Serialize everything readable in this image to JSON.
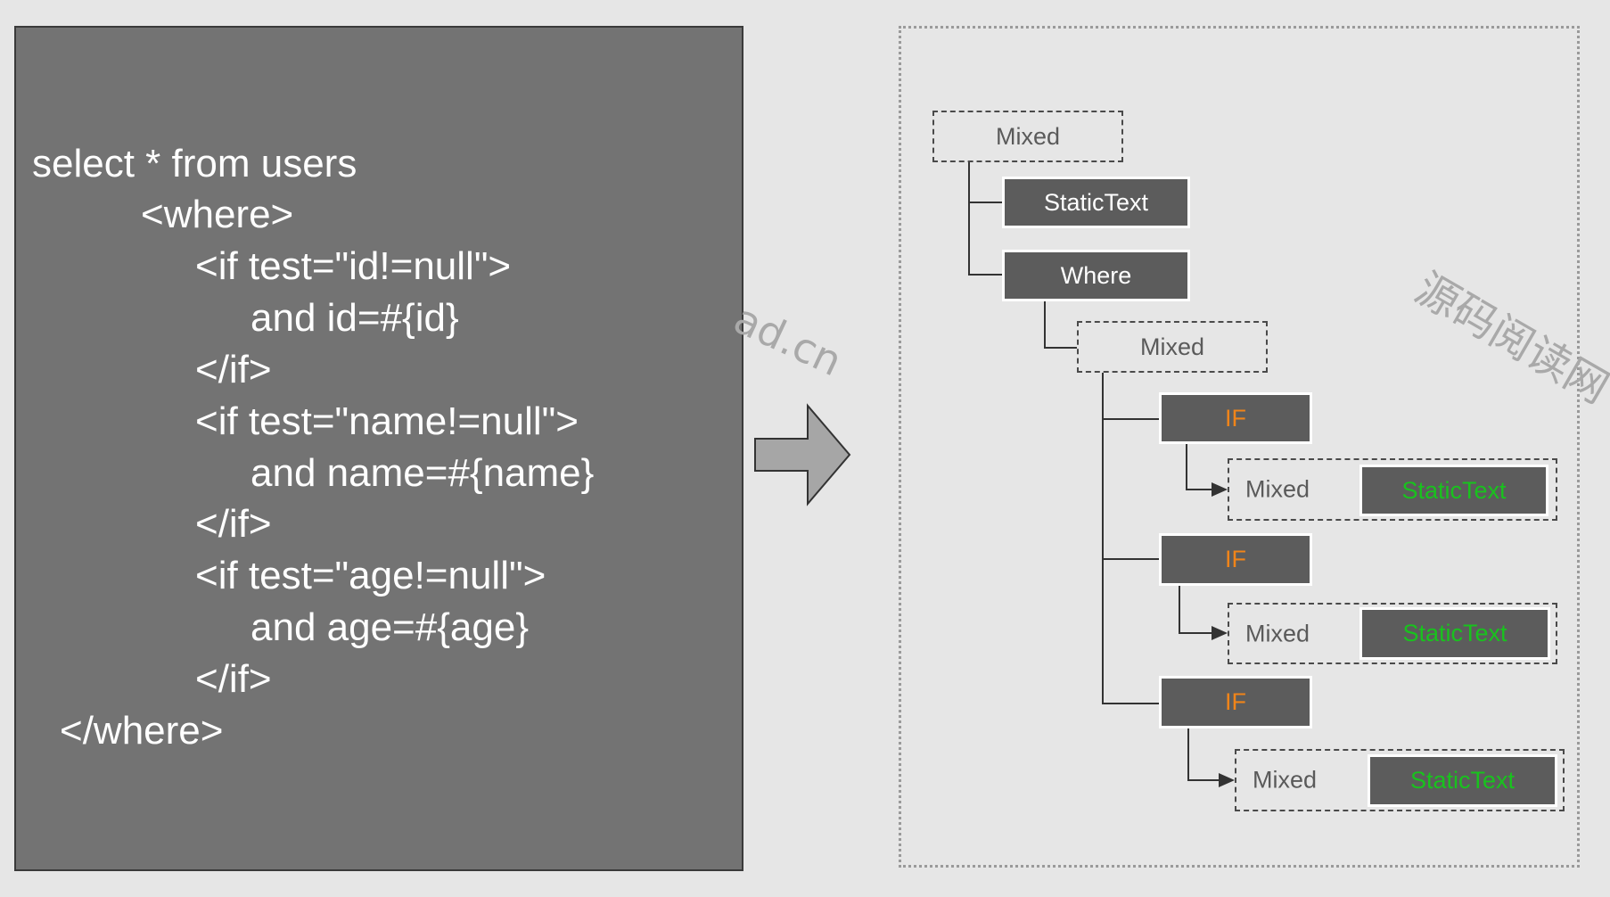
{
  "code": {
    "lines": [
      "select * from users",
      "<where>",
      "<if test=\"id!=null\">",
      "and id=#{id}",
      "</if>",
      "<if test=\"name!=null\">",
      "and name=#{name}",
      "</if>",
      "<if test=\"age!=null\">",
      "and age=#{age}",
      "</if>",
      "</where>"
    ]
  },
  "arrow": {
    "icon": "right-arrow-icon",
    "fill": "#a6a6a6"
  },
  "tree": {
    "root": {
      "label": "Mixed"
    },
    "static_text": {
      "label": "StaticText"
    },
    "where": {
      "label": "Where"
    },
    "where_mixed": {
      "label": "Mixed"
    },
    "if_nodes": [
      {
        "label": "IF",
        "child_group": {
          "label": "Mixed",
          "inner": "StaticText"
        }
      },
      {
        "label": "IF",
        "child_group": {
          "label": "Mixed",
          "inner": "StaticText"
        }
      },
      {
        "label": "IF",
        "child_group": {
          "label": "Mixed",
          "inner": "StaticText"
        }
      }
    ]
  },
  "colors": {
    "if_text": "#f08419",
    "static_text_green": "#19c21e",
    "node_fill": "#5c5c5c",
    "code_panel": "#737373"
  },
  "watermarks": {
    "left": "ad.cn",
    "right": "源码阅读网"
  }
}
